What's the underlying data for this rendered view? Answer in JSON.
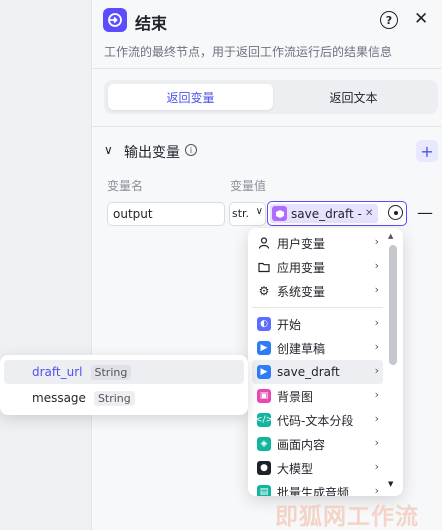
{
  "node": {
    "title": "结束",
    "description": "工作流的最终节点，用于返回工作流运行后的结果信息"
  },
  "mode_tabs": [
    "返回变量",
    "返回文本"
  ],
  "output_section": {
    "title": "输出变量",
    "col_name": "变量名",
    "col_value": "变量值",
    "row": {
      "name_value": "output",
      "type_value": "str.",
      "ref_text": "save_draft - d·"
    }
  },
  "dropdown": {
    "groups": [
      {
        "label": "用户变量",
        "icon": "user-icon"
      },
      {
        "label": "应用变量",
        "icon": "folder-icon"
      },
      {
        "label": "系统变量",
        "icon": "gear-icon"
      }
    ],
    "nodes": [
      {
        "label": "开始",
        "icon": "start-node-icon",
        "color": "#5b6cff"
      },
      {
        "label": "创建草稿",
        "icon": "plugin-node-icon",
        "color": "#2f7cf6"
      },
      {
        "label": "save_draft",
        "icon": "plugin-node-icon",
        "color": "#2f7cf6",
        "highlighted": true
      },
      {
        "label": "背景图",
        "icon": "image-node-icon",
        "color": "#e64bb4"
      },
      {
        "label": "代码-文本分段",
        "icon": "code-node-icon",
        "color": "#13b5a0"
      },
      {
        "label": "画面内容",
        "icon": "llm-node-icon",
        "color": "#13b5a0"
      },
      {
        "label": "大模型",
        "icon": "model-node-icon",
        "color": "#1f2329"
      },
      {
        "label": "批量生成音频",
        "icon": "batch-node-icon",
        "color": "#13b5a0"
      }
    ]
  },
  "subpanel": {
    "items": [
      {
        "name": "draft_url",
        "type": "String",
        "selected": true
      },
      {
        "name": "message",
        "type": "String",
        "selected": false
      }
    ]
  },
  "watermark": "即狐网工作流",
  "colors": {
    "accent": "#4d53e8",
    "node_icon": "#5b4dff"
  }
}
